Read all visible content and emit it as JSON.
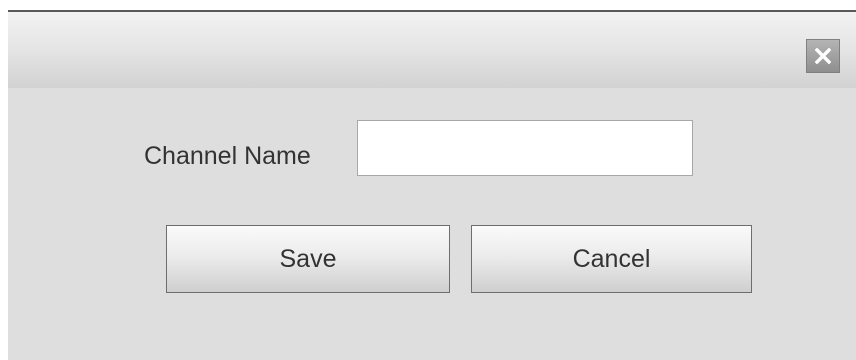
{
  "dialog": {
    "close_icon": "close-icon",
    "field": {
      "label": "Channel Name",
      "value": "",
      "placeholder": ""
    },
    "buttons": {
      "save_label": "Save",
      "cancel_label": "Cancel"
    }
  }
}
